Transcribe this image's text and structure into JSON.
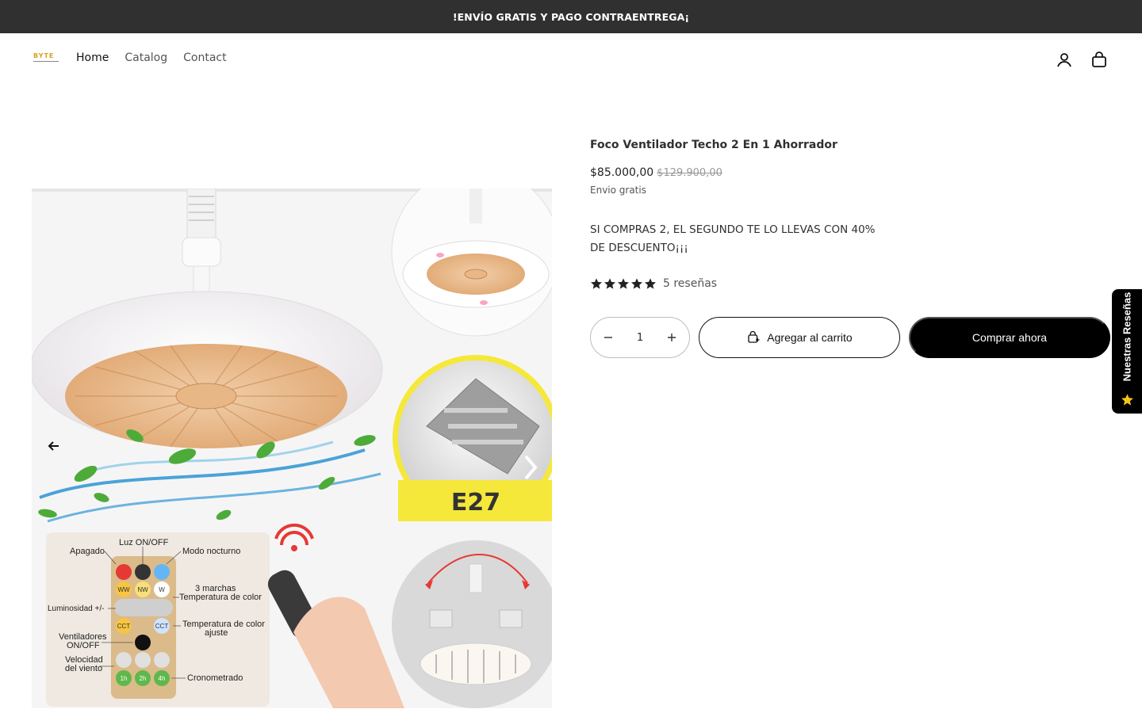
{
  "announcement": {
    "text": "!ENVÍO GRATIS Y PAGO CONTRAENTREGA¡"
  },
  "header": {
    "logo_text": "BYTE",
    "nav": [
      {
        "label": "Home"
      },
      {
        "label": "Catalog"
      },
      {
        "label": "Contact"
      }
    ],
    "icons": [
      "account-icon",
      "cart-icon"
    ]
  },
  "product": {
    "title": "Foco Ventilador Techo 2 En 1 Ahorrador",
    "price": "$85.000,00",
    "compare_price": "$129.900,00",
    "shipping": "Envio gratis",
    "promo": "SI COMPRAS 2, EL SEGUNDO TE LO LLEVAS CON 40% DE DESCUENTO¡¡¡",
    "rating": {
      "stars": 5,
      "label": "5 reseñas"
    },
    "quantity": "1",
    "add_to_cart": "Agregar al carrito",
    "buy_now": "Comprar ahora"
  },
  "gallery": {
    "remote_labels": {
      "luz": "Luz ON/OFF",
      "apagado": "Apagado",
      "nocturno": "Modo nocturno",
      "marchas1": "3 marchas",
      "marchas2": "Temperatura de color",
      "luminosidad": "Luminosidad +/-",
      "ajuste1": "Temperatura de color",
      "ajuste2": "ajuste",
      "vent1": "Ventiladores",
      "vent2": "ON/OFF",
      "vel1": "Velocidad",
      "vel2": "del viento",
      "crono": "Cronometrado"
    },
    "socket_label": "E27",
    "buttons": [
      "WW",
      "NW",
      "W",
      "CCT",
      "CCT",
      "1h",
      "2h",
      "4h"
    ]
  },
  "reviews_tab": {
    "label": "Nuestras Reseñas"
  },
  "colors": {
    "accent": "#000000",
    "announcement_bg": "#303030",
    "star": "#222222",
    "fan_blades": "#e8b786"
  }
}
